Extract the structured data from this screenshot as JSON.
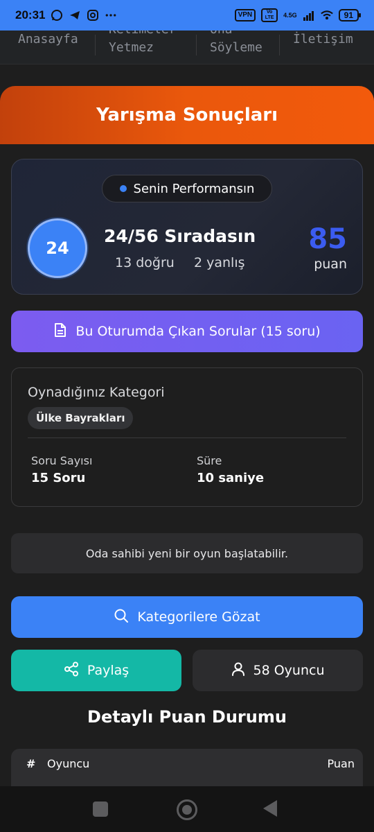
{
  "status_bar": {
    "time": "20:31",
    "vpn": "VPN",
    "volte": "Vo LTE",
    "network": "4.5G",
    "battery": "91"
  },
  "top_nav": {
    "items": [
      "Anasayfa",
      "Kelimeler",
      "Yetmez",
      "Ona",
      "Söyleme",
      "İletişim"
    ]
  },
  "header": {
    "title": "Yarışma Sonuçları"
  },
  "performance": {
    "badge_label": "Senin Performansın",
    "rank_number": "24",
    "rank_text": "24/56 Sıradasın",
    "correct": "13 doğru",
    "wrong": "2 yanlış",
    "score": "85",
    "score_unit": "puan"
  },
  "questions_button": {
    "label": "Bu Oturumda Çıkan Sorular (15 soru)"
  },
  "category_card": {
    "title": "Oynadığınız Kategori",
    "category": "Ülke Bayrakları",
    "question_count_label": "Soru Sayısı",
    "question_count_value": "15 Soru",
    "duration_label": "Süre",
    "duration_value": "10 saniye"
  },
  "notice": {
    "text": "Oda sahibi yeni bir oyun başlatabilir."
  },
  "actions": {
    "browse_label": "Kategorilere Gözat",
    "share_label": "Paylaş",
    "players_label": "58 Oyuncu"
  },
  "scoreboard": {
    "title": "Detaylı Puan Durumu",
    "col_rank": "#",
    "col_player": "Oyuncu",
    "col_score": "Puan"
  },
  "colors": {
    "header_gradient": [
      "#c2410c",
      "#f25a0c"
    ],
    "primary_blue": "#3b82f6",
    "purple": "#7c5cf0",
    "teal": "#14b8a6"
  }
}
